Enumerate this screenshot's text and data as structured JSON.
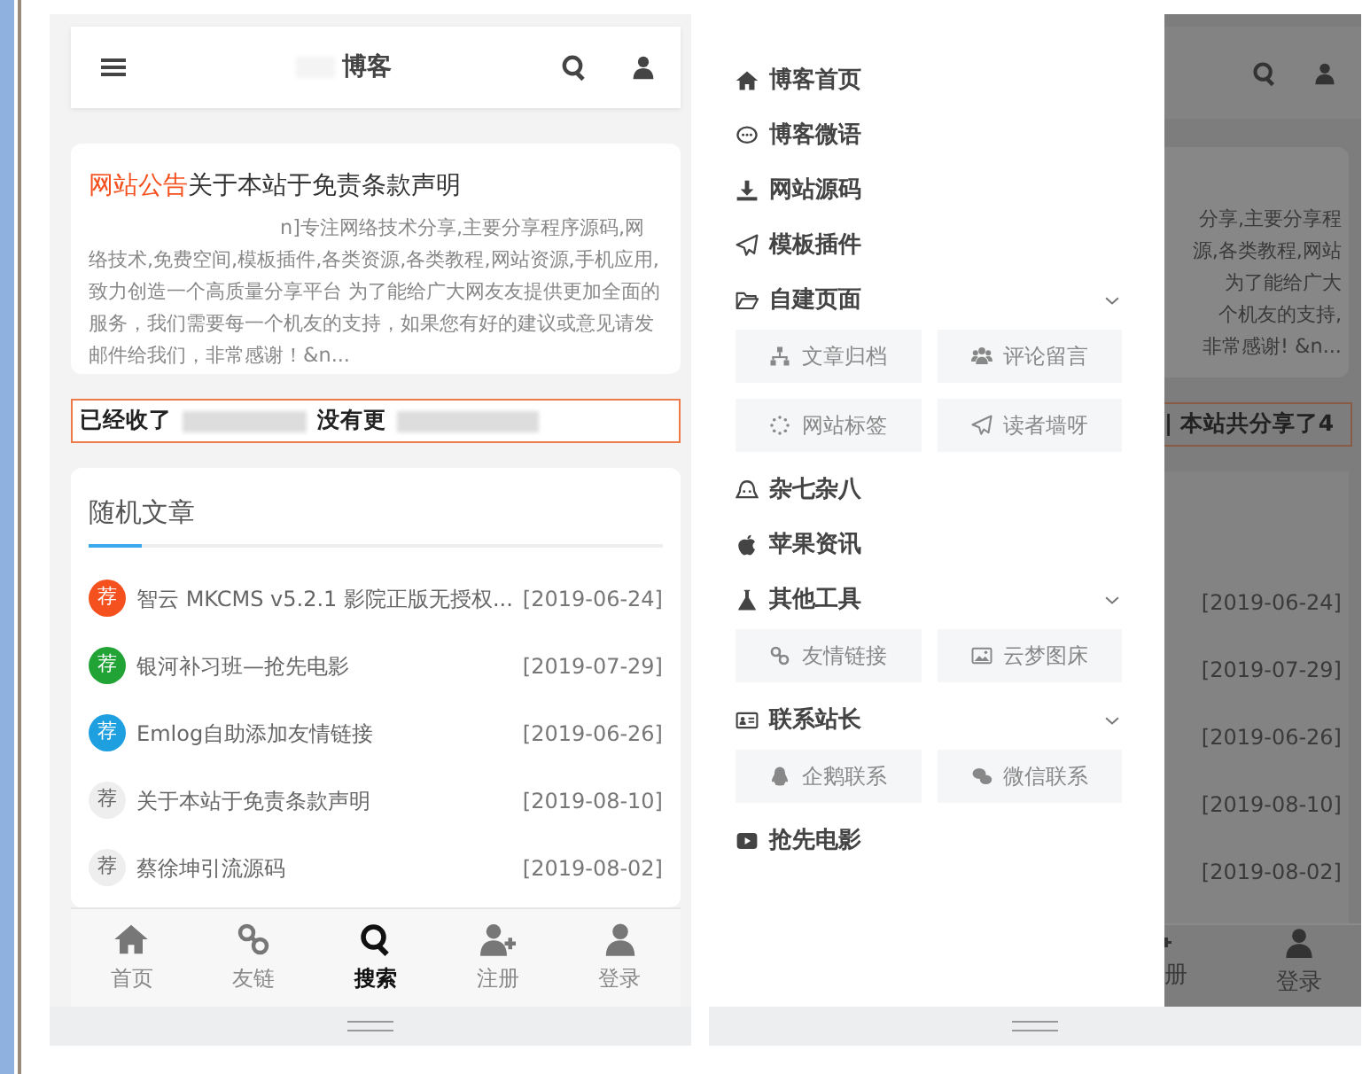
{
  "left_screen": {
    "header": {
      "title": "博客"
    },
    "notice": {
      "label": "网站公告",
      "title": "关于本站于免责条款声明",
      "body": "n]专注网络技术分享,主要分享程序源码,网络技术,免费空间,模板插件,各类资源,各类教程,网站资源,手机应用,致力创造一个高质量分享平台  为了能给广大网友友提供更加全面的服务，我们需要每一个机友的支持，如果您有好的建议或意见请发邮件给我们，非常感谢！&n..."
    },
    "marquee": {
      "parts": [
        "已经收了",
        "没有更"
      ]
    },
    "random_posts": {
      "title": "随机文章",
      "items": [
        {
          "badge": "荐",
          "color": "#f4511e",
          "title": "智云 MKCMS v5.2.1 影院正版无授权...",
          "date": "[2019-06-24]"
        },
        {
          "badge": "荐",
          "color": "#21a336",
          "title": "银河补习班—抢先电影",
          "date": "[2019-07-29]"
        },
        {
          "badge": "荐",
          "color": "#1e9fe0",
          "title": "Emlog自助添加友情链接",
          "date": "[2019-06-26]"
        },
        {
          "badge": "荐",
          "color": "#eeeeee",
          "title": "关于本站于免责条款声明",
          "date": "[2019-08-10]"
        },
        {
          "badge": "荐",
          "color": "#eeeeee",
          "title": "蔡徐坤引流源码",
          "date": "[2019-08-02]"
        }
      ]
    },
    "bottom_nav": [
      {
        "label": "首页",
        "selected": false
      },
      {
        "label": "友链",
        "selected": false
      },
      {
        "label": "搜索",
        "selected": true
      },
      {
        "label": "注册",
        "selected": false
      },
      {
        "label": "登录",
        "selected": false
      }
    ]
  },
  "right_screen": {
    "drawer": {
      "items": [
        {
          "label": "博客首页"
        },
        {
          "label": "博客微语"
        },
        {
          "label": "网站源码"
        },
        {
          "label": "模板插件"
        },
        {
          "label": "自建页面",
          "expanded": true,
          "children": [
            {
              "label": "文章归档"
            },
            {
              "label": "评论留言"
            },
            {
              "label": "网站标签"
            },
            {
              "label": "读者墙呀"
            }
          ]
        },
        {
          "label": "杂七杂八"
        },
        {
          "label": "苹果资讯"
        },
        {
          "label": "其他工具",
          "expanded": true,
          "children": [
            {
              "label": "友情链接"
            },
            {
              "label": "云梦图床"
            }
          ]
        },
        {
          "label": "联系站长",
          "expanded": true,
          "children": [
            {
              "label": "企鹅联系"
            },
            {
              "label": "微信联系"
            }
          ]
        },
        {
          "label": "抢先电影"
        }
      ]
    },
    "background": {
      "notice_lines": [
        "分享,主要分享程",
        "源,各类教程,网站",
        "为了能给广大",
        "个机友的支持,",
        "非常感谢! &n..."
      ],
      "marquee": "| 本站共分享了4",
      "dates": [
        "[2019-06-24]",
        "[2019-07-29]",
        "[2019-06-26]",
        "[2019-08-10]",
        "[2019-08-02]"
      ],
      "nav_fragment": "册",
      "nav_label": "登录"
    }
  }
}
